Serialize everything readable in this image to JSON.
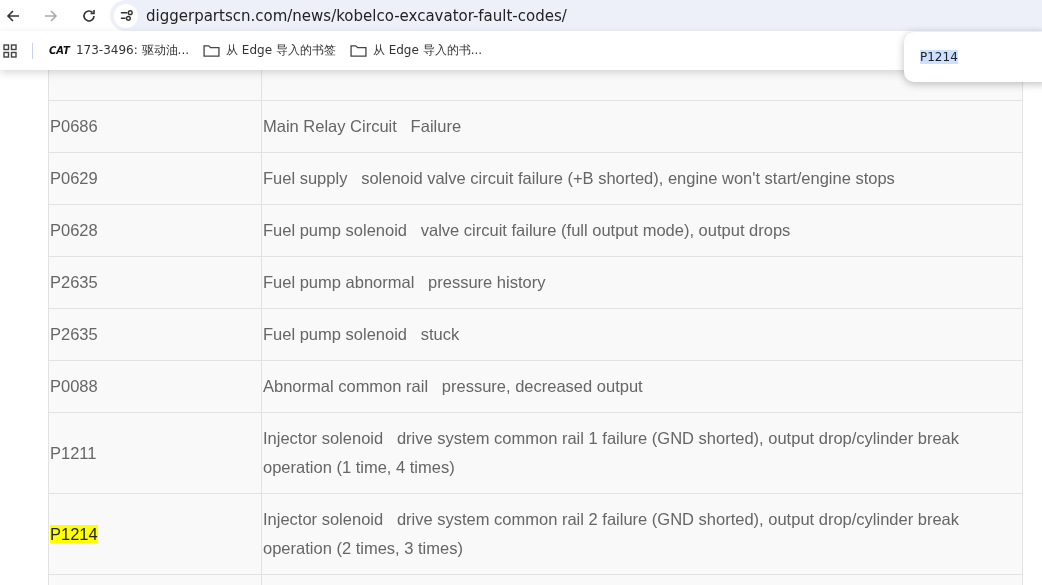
{
  "browser": {
    "url": "diggerpartscn.com/news/kobelco-excavator-fault-codes/",
    "forward_disabled": true
  },
  "bookmarks": [
    {
      "kind": "logo",
      "logo": "CAT",
      "label": "173-3496: 驱动油..."
    },
    {
      "kind": "folder",
      "label": "从 Edge 导入的书签"
    },
    {
      "kind": "folder",
      "label": "从 Edge 导入的书..."
    }
  ],
  "find_bar": {
    "query": "P1214"
  },
  "table": {
    "rows": [
      {
        "code": "P0686",
        "description": "Main Relay Circuit   Failure",
        "highlighted": false
      },
      {
        "code": "P0629",
        "description": "Fuel supply   solenoid valve circuit failure (+B shorted), engine won't start/engine stops",
        "highlighted": false
      },
      {
        "code": "P0628",
        "description": "Fuel pump solenoid   valve circuit failure (full output mode), output drops",
        "highlighted": false
      },
      {
        "code": "P2635",
        "description": "Fuel pump abnormal   pressure history",
        "highlighted": false
      },
      {
        "code": "P2635",
        "description": "Fuel pump solenoid   stuck",
        "highlighted": false
      },
      {
        "code": "P0088",
        "description": "Abnormal common rail   pressure, decreased output",
        "highlighted": false
      },
      {
        "code": "P1211",
        "description": "Injector solenoid   drive system common rail 1 failure (GND shorted), output drop/cylinder break operation (1 time, 4 times)",
        "highlighted": false
      },
      {
        "code": "P1214",
        "description": "Injector solenoid   drive system common rail 2 failure (GND shorted), output drop/cylinder break operation (2 times, 3 times)",
        "highlighted": true
      }
    ]
  }
}
